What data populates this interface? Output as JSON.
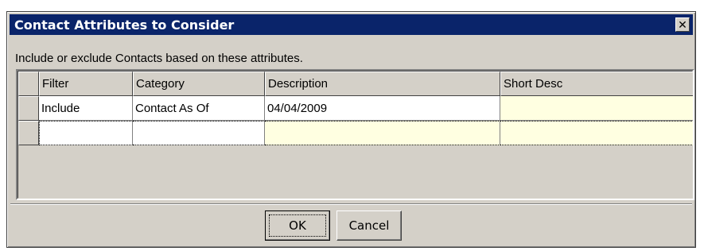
{
  "window": {
    "title": "Contact Attributes to Consider",
    "close_glyph": "✕"
  },
  "instructions": "Include or exclude Contacts based on these attributes.",
  "grid": {
    "columns": [
      "Filter",
      "Category",
      "Description",
      "Short Desc"
    ],
    "rows": [
      {
        "filter": "Include",
        "category": "Contact As Of",
        "description": "04/04/2009",
        "short_desc": ""
      },
      {
        "filter": "",
        "category": "",
        "description": "",
        "short_desc": ""
      }
    ]
  },
  "buttons": {
    "ok": "OK",
    "cancel": "Cancel"
  },
  "colors": {
    "titlebar": "#0a246a",
    "dialog_face": "#d4d0c8",
    "readonly_cell": "#ffffe1"
  }
}
